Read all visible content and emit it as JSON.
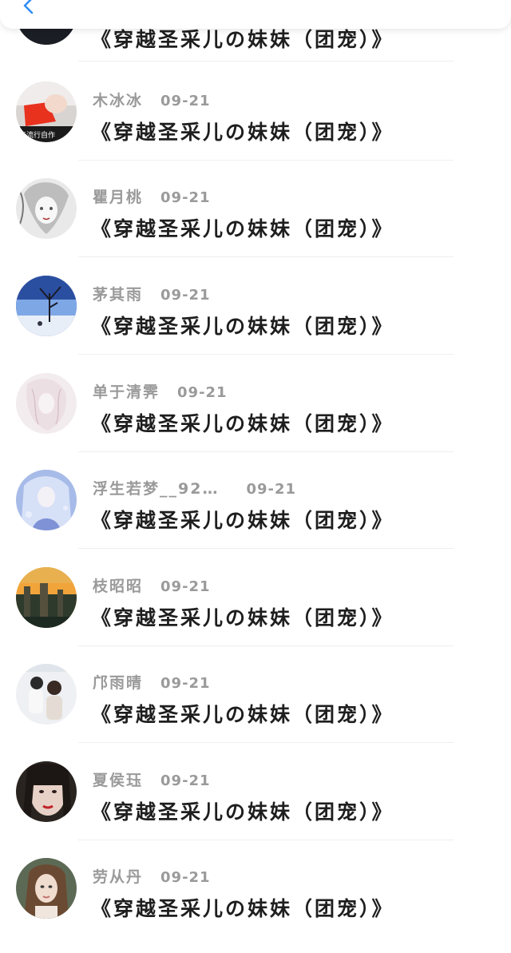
{
  "header": {
    "back_icon": "chevron-left-icon",
    "accent": "#2f8cf7"
  },
  "first_item": {
    "title": "《穿越圣采儿の妹妹（团宠）》"
  },
  "items": [
    {
      "user": "木冰冰",
      "date": "09-21",
      "title": "《穿越圣采儿の妹妹（团宠）》",
      "avatar_text": "年流行自作"
    },
    {
      "user": "瞿月桃",
      "date": "09-21",
      "title": "《穿越圣采儿の妹妹（团宠）》"
    },
    {
      "user": "茅其雨",
      "date": "09-21",
      "title": "《穿越圣采儿の妹妹（团宠）》"
    },
    {
      "user": "单于清霁",
      "date": "09-21",
      "title": "《穿越圣采儿の妹妹（团宠）》"
    },
    {
      "user": "浮生若梦__92…",
      "date": "09-21",
      "title": "《穿越圣采儿の妹妹（团宠）》"
    },
    {
      "user": "枝昭昭",
      "date": "09-21",
      "title": "《穿越圣采儿の妹妹（团宠）》"
    },
    {
      "user": "邝雨晴",
      "date": "09-21",
      "title": "《穿越圣采儿の妹妹（团宠）》"
    },
    {
      "user": "夏侯珏",
      "date": "09-21",
      "title": "《穿越圣采儿の妹妹（团宠）》"
    },
    {
      "user": "劳从丹",
      "date": "09-21",
      "title": "《穿越圣采儿の妹妹（团宠）》"
    }
  ]
}
